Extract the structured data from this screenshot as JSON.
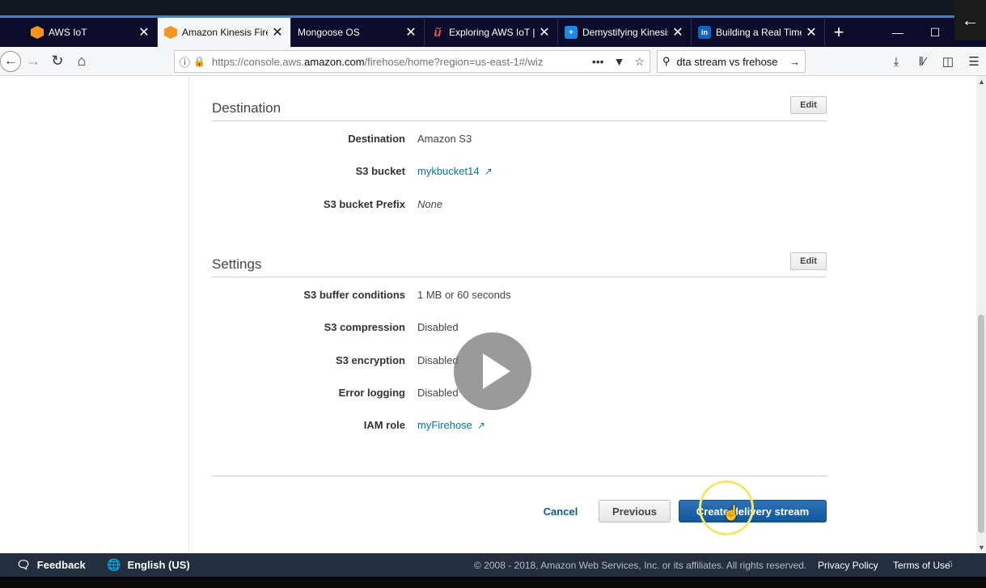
{
  "browser": {
    "tabs": [
      {
        "label": "AWS IoT",
        "icon": "aws-icon"
      },
      {
        "label": "Amazon Kinesis Fireh",
        "icon": "aws-icon",
        "active": true
      },
      {
        "label": "Mongoose OS",
        "icon": ""
      },
      {
        "label": "Exploring AWS IoT | U",
        "icon": "udemy-icon"
      },
      {
        "label": "Demystifying Kinesis",
        "icon": "plus-icon"
      },
      {
        "label": "Building a Real Time",
        "icon": "linkedin-icon"
      }
    ],
    "url_prefix": "https://console.aws.",
    "url_domain": "amazon.com",
    "url_suffix": "/firehose/home?region=us-east-1#/wiz",
    "search_value": "dta stream vs frehose"
  },
  "destination": {
    "title": "Destination",
    "edit_label": "Edit",
    "rows": [
      {
        "label": "Destination",
        "value": "Amazon S3"
      },
      {
        "label": "S3 bucket",
        "value": "mykbucket14"
      },
      {
        "label": "S3 bucket Prefix",
        "value": "None"
      }
    ]
  },
  "settings": {
    "title": "Settings",
    "edit_label": "Edit",
    "rows": [
      {
        "label": "S3 buffer conditions",
        "value": "1 MB or 60 seconds"
      },
      {
        "label": "S3 compression",
        "value": "Disabled"
      },
      {
        "label": "S3 encryption",
        "value": "Disabled"
      },
      {
        "label": "Error logging",
        "value": "Disabled"
      },
      {
        "label": "IAM role",
        "value": "myFirehose"
      }
    ]
  },
  "actions": {
    "cancel": "Cancel",
    "previous": "Previous",
    "create": "Create delivery stream"
  },
  "footer": {
    "feedback": "Feedback",
    "language": "English (US)",
    "copyright": "© 2008 - 2018, Amazon Web Services, Inc. or its affiliates. All rights reserved.",
    "privacy": "Privacy Policy",
    "terms": "Terms of Use"
  },
  "colors": {
    "link": "#0073bb",
    "primary_button": "#11579b",
    "footer_bg": "#232f3e",
    "tabbar_bg": "#0c0c2a"
  }
}
